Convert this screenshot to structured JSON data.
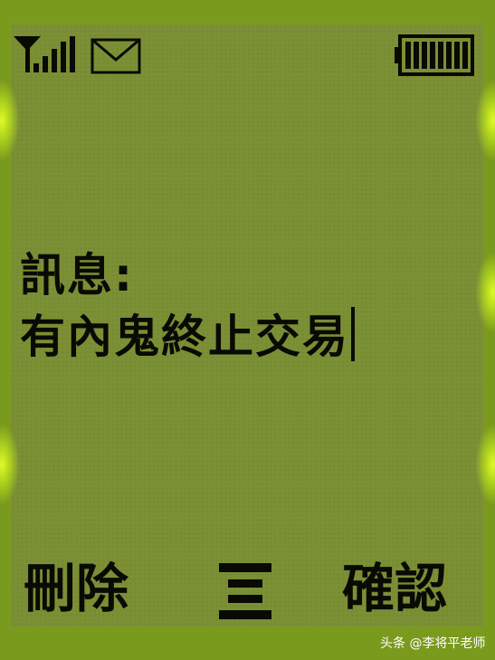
{
  "status_bar": {
    "signal_icon": "signal-bars-icon",
    "message_icon": "envelope-icon",
    "battery_icon": "battery-full-icon"
  },
  "message": {
    "label": "訊息:",
    "body": "有內鬼終止交易"
  },
  "softkeys": {
    "left": "刪除",
    "center_icon": "menu-icon",
    "right": "確認"
  },
  "watermark": "头条 @李将平老师",
  "colors": {
    "screen": "#7b9035",
    "bezel": "#7a9a1e",
    "glow": "#e6ff28",
    "text": "#0a0a05"
  }
}
